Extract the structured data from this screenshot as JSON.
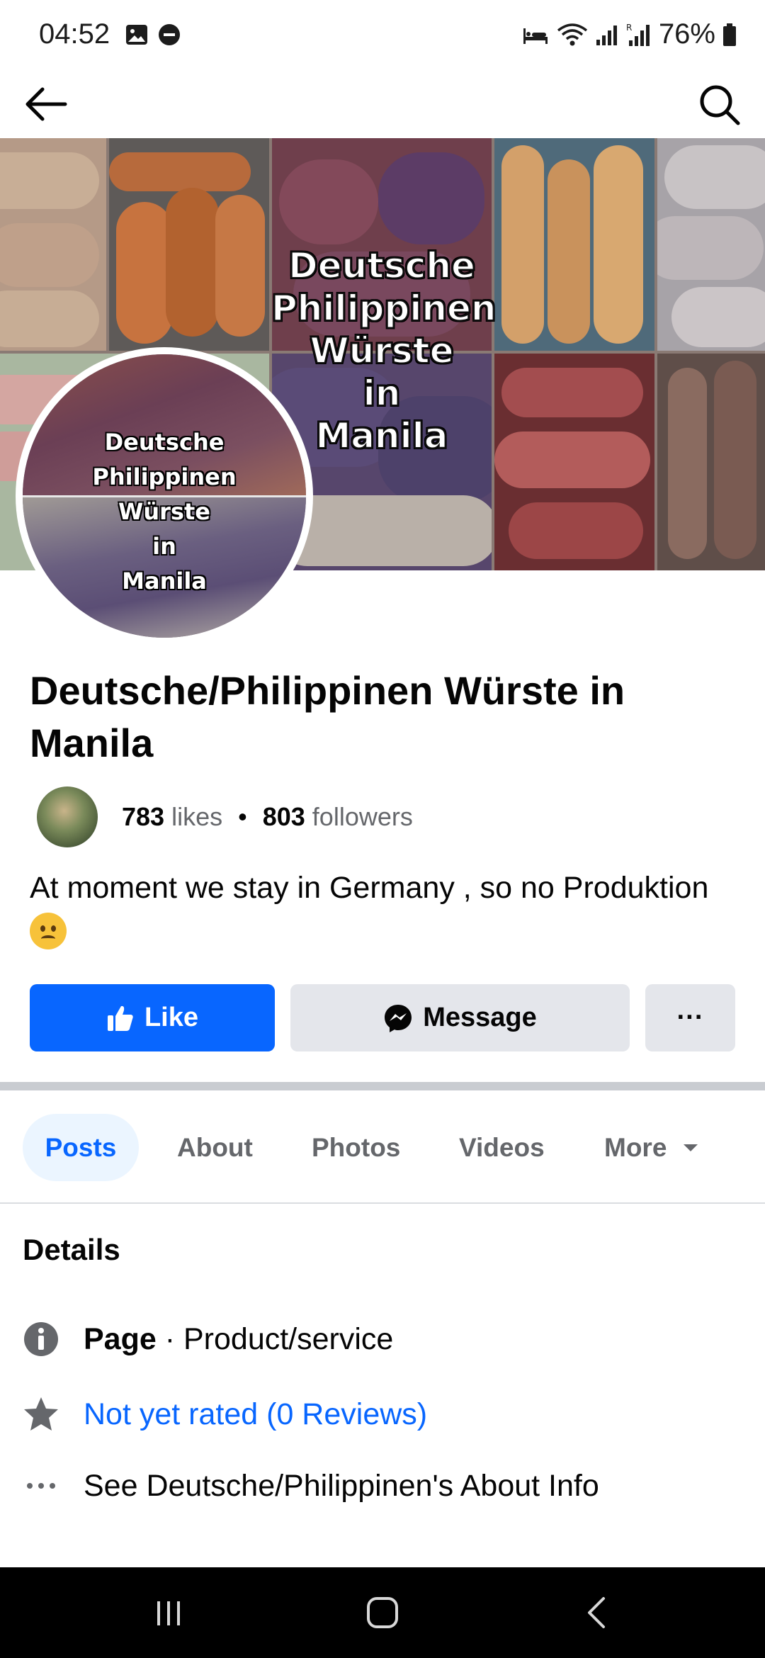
{
  "status_bar": {
    "time": "04:52",
    "battery": "76%",
    "icons": [
      "gallery-icon",
      "do-not-disturb-icon",
      "sleep-icon",
      "wifi-icon",
      "signal-icon",
      "signal-r-icon",
      "battery-icon"
    ]
  },
  "top_bar": {
    "back_icon": "arrow-left-icon",
    "search_icon": "search-icon"
  },
  "cover": {
    "overlay_lines": [
      "Deutsche",
      "Philippinen",
      "Würste",
      "in",
      "Manila"
    ]
  },
  "profile_picture": {
    "overlay_lines": [
      "Deutsche",
      "Philippinen",
      "Würste",
      "in",
      "Manila"
    ]
  },
  "page": {
    "title": "Deutsche/Philippinen Würste in Manila",
    "likes_count": "783",
    "likes_label": "likes",
    "followers_count": "803",
    "followers_label": "followers",
    "separator": "•",
    "description": "At moment we stay in Germany , so no Produktion"
  },
  "actions": {
    "like_label": "Like",
    "message_label": "Message",
    "more_label": "···"
  },
  "tabs": [
    {
      "label": "Posts",
      "active": true
    },
    {
      "label": "About",
      "active": false
    },
    {
      "label": "Photos",
      "active": false
    },
    {
      "label": "Videos",
      "active": false
    },
    {
      "label": "More",
      "active": false
    }
  ],
  "details": {
    "title": "Details",
    "page_type_bold": "Page",
    "page_type_rest": " · Product/service",
    "rating": "Not yet rated (0 Reviews)",
    "about_link": "See Deutsche/Philippinen's About Info"
  },
  "colors": {
    "accent": "#0866ff",
    "button_gray": "#e4e6eb",
    "secondary_text": "#65676b"
  }
}
